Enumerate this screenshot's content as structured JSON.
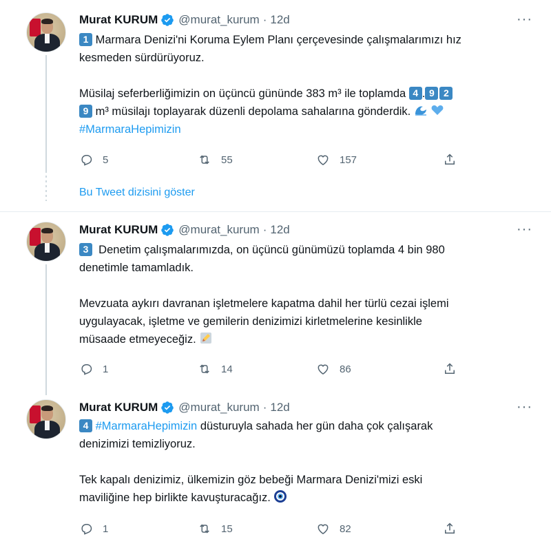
{
  "author": {
    "name": "Murat KURUM",
    "handle": "@murat_kurum",
    "separator": "·",
    "more_label": "···"
  },
  "show_thread_label": "Bu Tweet dizisini göster",
  "tweets": [
    {
      "time": "12d",
      "badge": "1",
      "line1": "Marmara Denizi'ni Koruma Eylem Planı çerçevesinde çalışmalarımızı hız",
      "line2": "kesmeden sürdürüyoruz.",
      "line3_pre": "Müsilaj seferberliğimizin on üçüncü gününde 383 m³ ile toplamda",
      "num_badges": [
        "4",
        "9",
        "2"
      ],
      "num_sep": ".",
      "line4_badge": "9",
      "line4_text": "m³ müsilajı toplayarak düzenli depolama sahalarına gönderdik.",
      "hashtag": "#MarmaraHepimizin",
      "emoji1": "water-wave-emoji",
      "emoji2": "blue-heart-emoji",
      "replies": "5",
      "retweets": "55",
      "likes": "157"
    },
    {
      "time": "12d",
      "badge": "3",
      "line1": "Denetim çalışmalarımızda, on üçüncü günümüzü toplamda 4 bin 980",
      "line2": "denetimle tamamladık.",
      "line3": "Mevzuata aykırı davranan işletmelere kapatma dahil her türlü cezai işlemi",
      "line4": "uygulayacak, işletme ve gemilerin denizimizi kirletmelerine kesinlikle",
      "line5": "müsaade etmeyeceğiz.",
      "emoji1": "pencil-emoji",
      "replies": "1",
      "retweets": "14",
      "likes": "86"
    },
    {
      "time": "12d",
      "badge": "4",
      "hashtag": "#MarmaraHepimizin",
      "line1_rest": "düsturuyla sahada her gün daha çok çalışarak",
      "line2": "denizimizi temizliyoruz.",
      "line3": "Tek kapalı denizimiz, ülkemizin göz bebeği Marmara Denizi'mizi eski",
      "line4": "maviliğine hep birlikte kavuşturacağız.",
      "emoji1": "nazar-amulet-emoji",
      "replies": "1",
      "retweets": "15",
      "likes": "82"
    }
  ],
  "colors": {
    "link": "#1d9bf0",
    "muted": "#536471",
    "keycap": "#3b88c3",
    "verified": "#1d9bf0"
  }
}
